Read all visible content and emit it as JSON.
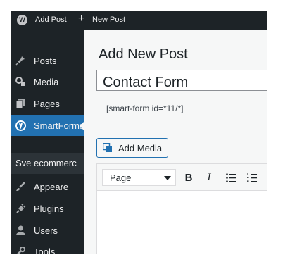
{
  "adminbar": {
    "add_post": "Add Post",
    "plus": "+",
    "new_post": "New Post"
  },
  "sidebar": {
    "items": [
      {
        "label": "Posts",
        "icon": "pin-icon"
      },
      {
        "label": "Media",
        "icon": "media-icon"
      },
      {
        "label": "Pages",
        "icon": "pages-icon"
      },
      {
        "label": "SmartForms",
        "icon": "smartforms-icon",
        "active": true
      },
      {
        "label": "Sve ecommerc",
        "icon": null
      },
      {
        "label": "Appeare",
        "icon": "brush-icon"
      },
      {
        "label": "Plugins",
        "icon": "plug-icon"
      },
      {
        "label": "Users",
        "icon": "user-icon"
      },
      {
        "label": "Tools",
        "icon": "wrench-icon"
      }
    ]
  },
  "main": {
    "page_title": "Add New Post",
    "post_title_value": "Contact Form",
    "shortcode": "[smart-form id=*11/*]",
    "add_media_label": "Add Media",
    "format_select_value": "Page",
    "toolbar_bold": "B",
    "toolbar_italic": "I"
  },
  "colors": {
    "sidebar_bg": "#1d2327",
    "active_bg": "#2271b1",
    "content_bg": "#f6f7f7"
  }
}
